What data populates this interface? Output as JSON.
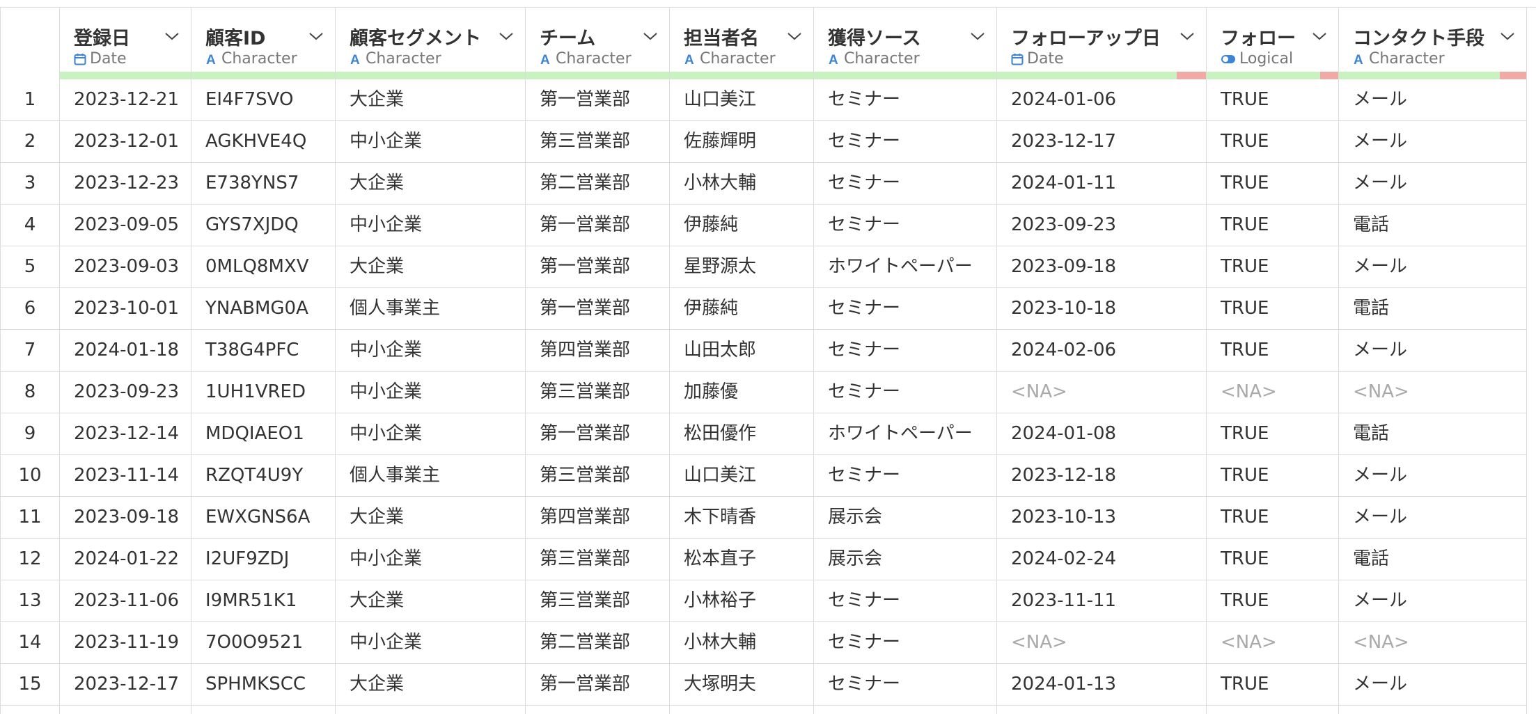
{
  "colors": {
    "quality_ok": "#c8f3c1",
    "quality_missing": "#efaaa5",
    "type_icon": "#3b84d6",
    "na_text": "#aaaaaa"
  },
  "columns": [
    {
      "name": "登録日",
      "type": "Date",
      "icon": "calendar-icon"
    },
    {
      "name": "顧客ID",
      "type": "Character",
      "icon": "character-icon"
    },
    {
      "name": "顧客セグメント",
      "type": "Character",
      "icon": "character-icon"
    },
    {
      "name": "チーム",
      "type": "Character",
      "icon": "character-icon"
    },
    {
      "name": "担当者名",
      "type": "Character",
      "icon": "character-icon"
    },
    {
      "name": "獲得ソース",
      "type": "Character",
      "icon": "character-icon"
    },
    {
      "name": "フォローアップ日",
      "type": "Date",
      "icon": "calendar-icon",
      "missing_fraction": 0.14
    },
    {
      "name": "フォロー",
      "type": "Logical",
      "icon": "toggle-icon",
      "missing_fraction": 0.14
    },
    {
      "name": "コンタクト手段",
      "type": "Character",
      "icon": "character-icon",
      "missing_fraction": 0.14
    }
  ],
  "rows": [
    {
      "n": "1",
      "cells": [
        "2023-12-21",
        "EI4F7SVO",
        "大企業",
        "第一営業部",
        "山口美江",
        "セミナー",
        "2024-01-06",
        "TRUE",
        "メール"
      ]
    },
    {
      "n": "2",
      "cells": [
        "2023-12-01",
        "AGKHVE4Q",
        "中小企業",
        "第三営業部",
        "佐藤輝明",
        "セミナー",
        "2023-12-17",
        "TRUE",
        "メール"
      ]
    },
    {
      "n": "3",
      "cells": [
        "2023-12-23",
        "E738YNS7",
        "大企業",
        "第二営業部",
        "小林大輔",
        "セミナー",
        "2024-01-11",
        "TRUE",
        "メール"
      ]
    },
    {
      "n": "4",
      "cells": [
        "2023-09-05",
        "GYS7XJDQ",
        "中小企業",
        "第一営業部",
        "伊藤純",
        "セミナー",
        "2023-09-23",
        "TRUE",
        "電話"
      ]
    },
    {
      "n": "5",
      "cells": [
        "2023-09-03",
        "0MLQ8MXV",
        "大企業",
        "第一営業部",
        "星野源太",
        "ホワイトペーパー",
        "2023-09-18",
        "TRUE",
        "メール"
      ]
    },
    {
      "n": "6",
      "cells": [
        "2023-10-01",
        "YNABMG0A",
        "個人事業主",
        "第一営業部",
        "伊藤純",
        "セミナー",
        "2023-10-18",
        "TRUE",
        "電話"
      ]
    },
    {
      "n": "7",
      "cells": [
        "2024-01-18",
        "T38G4PFC",
        "中小企業",
        "第四営業部",
        "山田太郎",
        "セミナー",
        "2024-02-06",
        "TRUE",
        "メール"
      ]
    },
    {
      "n": "8",
      "cells": [
        "2023-09-23",
        "1UH1VRED",
        "中小企業",
        "第三営業部",
        "加藤優",
        "セミナー",
        "<NA>",
        "<NA>",
        "<NA>"
      ]
    },
    {
      "n": "9",
      "cells": [
        "2023-12-14",
        "MDQIAEO1",
        "中小企業",
        "第一営業部",
        "松田優作",
        "ホワイトペーパー",
        "2024-01-08",
        "TRUE",
        "電話"
      ]
    },
    {
      "n": "10",
      "cells": [
        "2023-11-14",
        "RZQT4U9Y",
        "個人事業主",
        "第三営業部",
        "山口美江",
        "セミナー",
        "2023-12-18",
        "TRUE",
        "メール"
      ]
    },
    {
      "n": "11",
      "cells": [
        "2023-09-18",
        "EWXGNS6A",
        "大企業",
        "第四営業部",
        "木下晴香",
        "展示会",
        "2023-10-13",
        "TRUE",
        "メール"
      ]
    },
    {
      "n": "12",
      "cells": [
        "2024-01-22",
        "I2UF9ZDJ",
        "中小企業",
        "第三営業部",
        "松本直子",
        "展示会",
        "2024-02-24",
        "TRUE",
        "電話"
      ]
    },
    {
      "n": "13",
      "cells": [
        "2023-11-06",
        "I9MR51K1",
        "大企業",
        "第三営業部",
        "小林裕子",
        "セミナー",
        "2023-11-11",
        "TRUE",
        "メール"
      ]
    },
    {
      "n": "14",
      "cells": [
        "2023-11-19",
        "7O0O9521",
        "中小企業",
        "第二営業部",
        "小林大輔",
        "セミナー",
        "<NA>",
        "<NA>",
        "<NA>"
      ]
    },
    {
      "n": "15",
      "cells": [
        "2023-12-17",
        "SPHMKSCC",
        "大企業",
        "第一営業部",
        "大塚明夫",
        "セミナー",
        "2024-01-13",
        "TRUE",
        "メール"
      ]
    }
  ]
}
